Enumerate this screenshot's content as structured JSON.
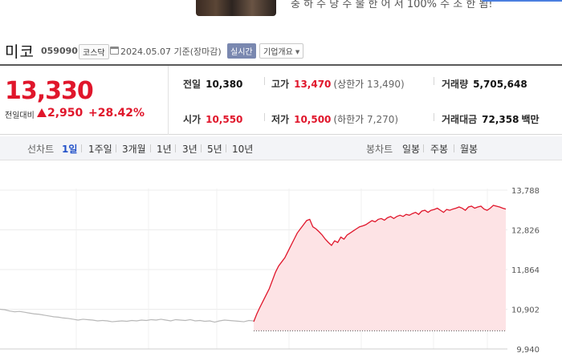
{
  "banner": {
    "text": "충 하 주 당 주 물 한 어 서 100% 주 조 한 됨!"
  },
  "header": {
    "name": "미코",
    "code": "059090",
    "market": "코스닥",
    "base_date": "2024.05.07",
    "base_label": "기준(장마감)",
    "realtime_label": "실시간",
    "company_label": "기업개요"
  },
  "price": {
    "current": "13,330",
    "change_label": "전일대비",
    "change_value": "2,950",
    "change_rate": "+28.42%",
    "up_color": "#e0162b"
  },
  "stats": {
    "prev_close_label": "전일",
    "prev_close": "10,380",
    "high_label": "고가",
    "high": "13,470",
    "upper_limit_label": "(상한가",
    "upper_limit": "13,490)",
    "volume_label": "거래량",
    "volume": "5,705,648",
    "open_label": "시가",
    "open": "10,550",
    "low_label": "저가",
    "low": "10,500",
    "lower_limit_label": "(하한가",
    "lower_limit": "7,270)",
    "amount_label": "거래대금",
    "amount": "72,358",
    "amount_unit": "백만"
  },
  "tabs": {
    "line_label": "선차트",
    "line_periods": [
      "1일",
      "1주일",
      "3개월",
      "1년",
      "3년",
      "5년",
      "10년"
    ],
    "active_period": "1일",
    "candle_label": "봉차트",
    "candle_periods": [
      "일봉",
      "주봉",
      "월봉"
    ]
  },
  "chart_data": {
    "type": "line",
    "y_ticks": [
      "13,788",
      "12,826",
      "11,864",
      "10,902",
      "9,940"
    ],
    "ylim": [
      9940,
      13788
    ],
    "baseline": 10380,
    "series": [
      {
        "values": [
          10902,
          10890,
          10860,
          10840,
          10850,
          10830,
          10810,
          10790,
          10780,
          10760,
          10740,
          10720,
          10710,
          10690,
          10680,
          10660,
          10640,
          10660,
          10650,
          10640,
          10620,
          10630,
          10620,
          10600,
          10610,
          10620,
          10610,
          10630,
          10620,
          10640,
          10630,
          10650,
          10640,
          10660,
          10640,
          10620,
          10650,
          10640,
          10630,
          10650,
          10620,
          10630,
          10610,
          10620,
          10590,
          10620,
          10640,
          10630,
          10620,
          10610,
          10600,
          10630,
          10620
        ],
        "color": "#b8b8b8"
      },
      {
        "values": [
          10600,
          10790,
          10950,
          11100,
          11250,
          11400,
          11600,
          11800,
          11950,
          12050,
          12150,
          12300,
          12450,
          12600,
          12750,
          12850,
          12950,
          13050,
          13080,
          12900,
          12850,
          12780,
          12700,
          12600,
          12520,
          12450,
          12560,
          12520,
          12650,
          12600,
          12700,
          12750,
          12800,
          12850,
          12900,
          12920,
          12950,
          13000,
          13050,
          13020,
          13080,
          13100,
          13060,
          13120,
          13150,
          13100,
          13150,
          13180,
          13150,
          13200,
          13180,
          13220,
          13250,
          13200,
          13280,
          13300,
          13250,
          13300,
          13320,
          13350,
          13300,
          13250,
          13320,
          13300,
          13330,
          13350,
          13380,
          13350,
          13300,
          13380,
          13400,
          13350,
          13380,
          13400,
          13330,
          13300,
          13350,
          13420,
          13400,
          13380,
          13350,
          13330
        ],
        "color": "#e0162b"
      }
    ]
  }
}
